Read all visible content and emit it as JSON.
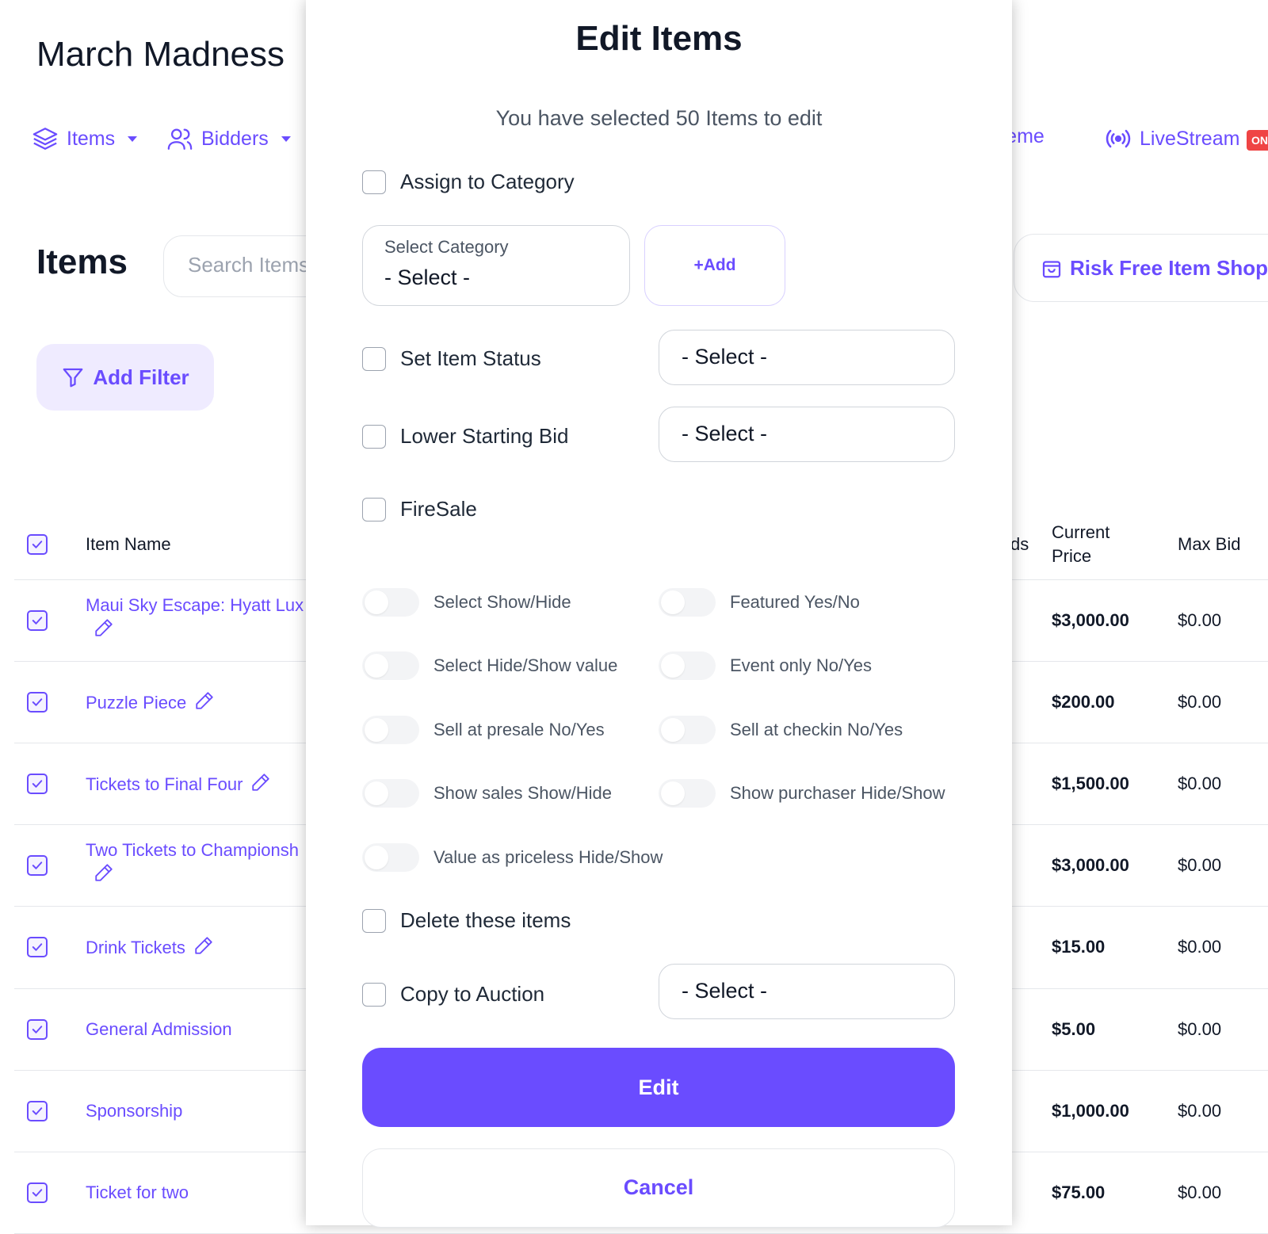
{
  "page": {
    "title": "March Madness",
    "section_title": "Items",
    "search_placeholder": "Search Items",
    "filter_label": "Add Filter",
    "risk_free_label": "Risk Free Item Shop",
    "nav": {
      "items": "Items",
      "bidders": "Bidders",
      "theme": "Theme",
      "livestream": "LiveStream",
      "live_badge": "ON"
    },
    "table": {
      "headers": {
        "item_name": "Item Name",
        "bids_partial": "ds",
        "current_price": "Current Price",
        "max_bid": "Max Bid"
      },
      "rows": [
        {
          "name": "Maui Sky Escape: Hyatt Lux",
          "price": "$3,000.00",
          "max_bid": "$0.00"
        },
        {
          "name": "Puzzle Piece",
          "price": "$200.00",
          "max_bid": "$0.00"
        },
        {
          "name": "Tickets to Final Four",
          "price": "$1,500.00",
          "max_bid": "$0.00"
        },
        {
          "name": "Two Tickets to Championsh",
          "price": "$3,000.00",
          "max_bid": "$0.00"
        },
        {
          "name": "Drink Tickets",
          "price": "$15.00",
          "max_bid": "$0.00"
        },
        {
          "name": "General Admission",
          "price": "$5.00",
          "max_bid": "$0.00"
        },
        {
          "name": "Sponsorship",
          "price": "$1,000.00",
          "max_bid": "$0.00"
        },
        {
          "name": "Ticket for two",
          "price": "$75.00",
          "max_bid": "$0.00"
        }
      ]
    }
  },
  "modal": {
    "title": "Edit Items",
    "subtitle": "You have selected 50 Items to edit",
    "assign_category": "Assign to Category",
    "category_label": "Select Category",
    "category_value": "- Select -",
    "add_label": "+Add",
    "set_status": "Set Item Status",
    "set_status_value": "- Select -",
    "lower_bid": "Lower Starting Bid",
    "lower_bid_value": "- Select -",
    "firesale": "FireSale",
    "toggles": {
      "show_hide": "Select Show/Hide",
      "featured": "Featured Yes/No",
      "hide_show_value": "Select Hide/Show value",
      "event_only": "Event only No/Yes",
      "presale": "Sell at presale No/Yes",
      "checkin": "Sell at checkin No/Yes",
      "show_sales": "Show sales Show/Hide",
      "show_purchaser": "Show purchaser Hide/Show",
      "priceless": "Value as priceless Hide/Show"
    },
    "delete_label": "Delete these items",
    "copy_label": "Copy to Auction",
    "copy_value": "- Select -",
    "edit_button": "Edit",
    "cancel_button": "Cancel"
  },
  "colors": {
    "accent": "#6a4cff",
    "accent_soft": "#efebff",
    "badge": "#ef4444"
  }
}
